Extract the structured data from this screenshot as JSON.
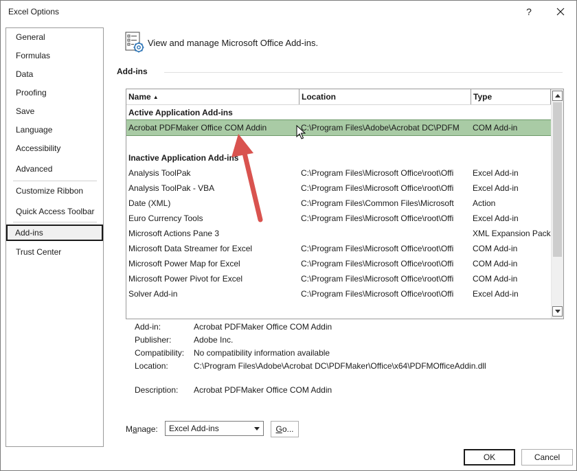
{
  "window": {
    "title": "Excel Options",
    "help": "?"
  },
  "nav": {
    "items": [
      {
        "label": "General"
      },
      {
        "label": "Formulas"
      },
      {
        "label": "Data"
      },
      {
        "label": "Proofing"
      },
      {
        "label": "Save"
      },
      {
        "label": "Language"
      },
      {
        "label": "Accessibility"
      },
      {
        "label": "Advanced"
      },
      {
        "label": "Customize Ribbon"
      },
      {
        "label": "Quick Access Toolbar"
      },
      {
        "label": "Add-ins",
        "selected": true
      },
      {
        "label": "Trust Center"
      }
    ]
  },
  "header": {
    "text": "View and manage Microsoft Office Add-ins.",
    "section_title": "Add-ins",
    "icon": "addins-gear-icon"
  },
  "table": {
    "columns": [
      {
        "label": "Name",
        "sort": "ascending"
      },
      {
        "label": "Location"
      },
      {
        "label": "Type"
      }
    ],
    "active_group": "Active Application Add-ins",
    "active_rows": [
      {
        "name": "Acrobat PDFMaker Office COM Addin",
        "location": "C:\\Program Files\\Adobe\\Acrobat DC\\PDFM",
        "type": "COM Add-in",
        "selected": true
      }
    ],
    "inactive_group": "Inactive Application Add-ins",
    "inactive_rows": [
      {
        "name": "Analysis ToolPak",
        "location": "C:\\Program Files\\Microsoft Office\\root\\Offi",
        "type": "Excel Add-in"
      },
      {
        "name": "Analysis ToolPak - VBA",
        "location": "C:\\Program Files\\Microsoft Office\\root\\Offi",
        "type": "Excel Add-in"
      },
      {
        "name": "Date (XML)",
        "location": "C:\\Program Files\\Common Files\\Microsoft",
        "type": "Action"
      },
      {
        "name": "Euro Currency Tools",
        "location": "C:\\Program Files\\Microsoft Office\\root\\Offi",
        "type": "Excel Add-in"
      },
      {
        "name": "Microsoft Actions Pane 3",
        "location": "",
        "type": "XML Expansion Pack"
      },
      {
        "name": "Microsoft Data Streamer for Excel",
        "location": "C:\\Program Files\\Microsoft Office\\root\\Offi",
        "type": "COM Add-in"
      },
      {
        "name": "Microsoft Power Map for Excel",
        "location": "C:\\Program Files\\Microsoft Office\\root\\Offi",
        "type": "COM Add-in"
      },
      {
        "name": "Microsoft Power Pivot for Excel",
        "location": "C:\\Program Files\\Microsoft Office\\root\\Offi",
        "type": "COM Add-in"
      },
      {
        "name": "Solver Add-in",
        "location": "C:\\Program Files\\Microsoft Office\\root\\Offi",
        "type": "Excel Add-in"
      }
    ]
  },
  "details": {
    "addin_label": "Add-in:",
    "addin_value": "Acrobat PDFMaker Office COM Addin",
    "publisher_label": "Publisher:",
    "publisher_value": "Adobe Inc.",
    "compat_label": "Compatibility:",
    "compat_value": "No compatibility information available",
    "location_label": "Location:",
    "location_value": "C:\\Program Files\\Adobe\\Acrobat DC\\PDFMaker\\Office\\x64\\PDFMOfficeAddin.dll",
    "description_label": "Description:",
    "description_value": "Acrobat PDFMaker Office COM Addin"
  },
  "manage": {
    "label_prefix": "M",
    "label_accel": "a",
    "label_suffix": "nage:",
    "selected": "Excel Add-ins",
    "go_accel": "G",
    "go_suffix": "o..."
  },
  "buttons": {
    "ok": "OK",
    "cancel": "Cancel"
  },
  "colors": {
    "selected_row": "#a9cba5",
    "annotation_arrow": "#d9534f"
  }
}
